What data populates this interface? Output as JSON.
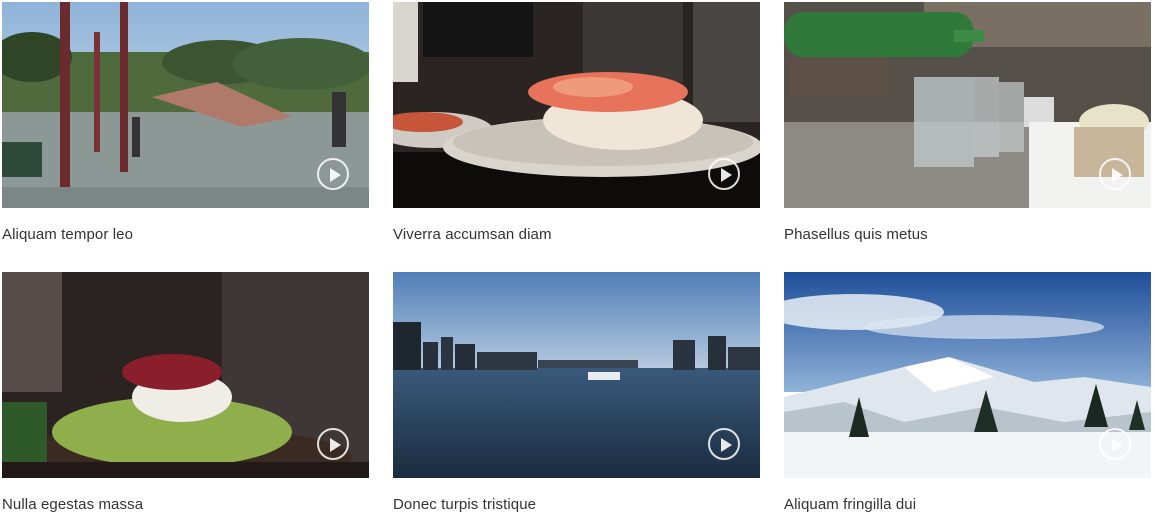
{
  "videos": [
    {
      "title": "Aliquam tempor leo",
      "play_icon": "play-circle-icon"
    },
    {
      "title": "Viverra accumsan diam",
      "play_icon": "play-circle-icon"
    },
    {
      "title": "Phasellus quis metus",
      "play_icon": "play-circle-icon"
    },
    {
      "title": "Nulla egestas massa",
      "play_icon": "play-circle-icon"
    },
    {
      "title": "Donec turpis tristique",
      "play_icon": "play-circle-icon"
    },
    {
      "title": "Aliquam fringilla dui",
      "play_icon": "play-circle-icon"
    }
  ]
}
